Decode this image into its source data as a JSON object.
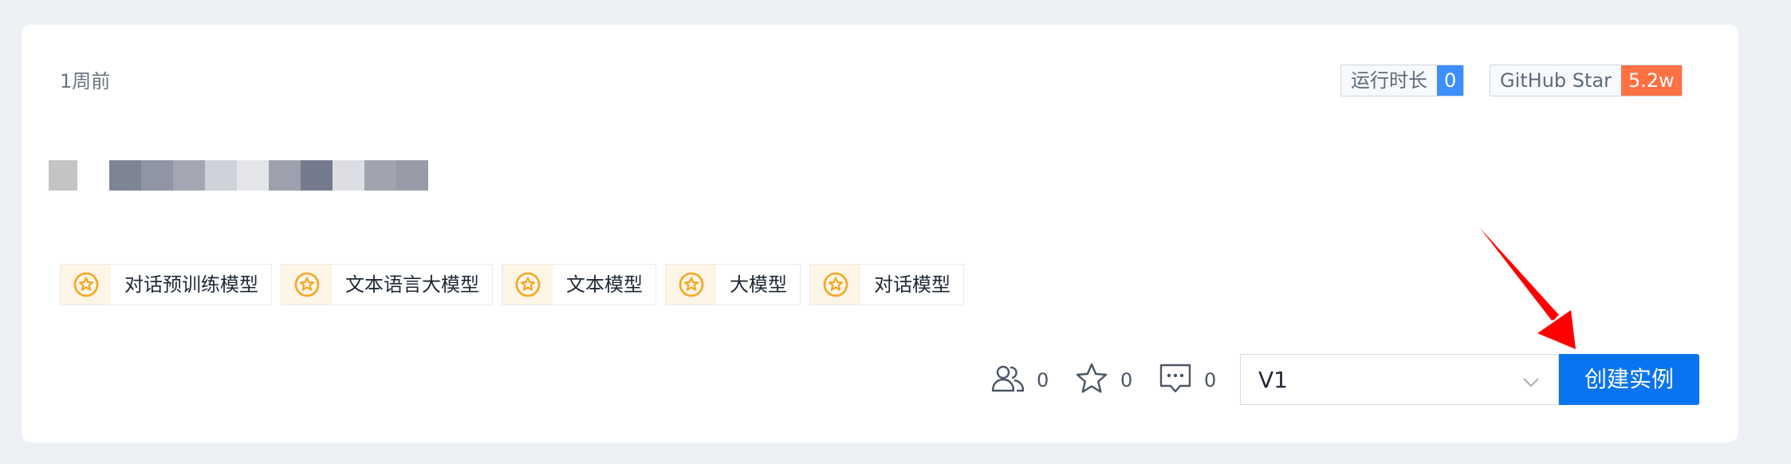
{
  "card": {
    "timestamp": "1周前"
  },
  "badges": {
    "runtime_label": "运行时长",
    "runtime_value": "0",
    "star_label": "GitHub Star",
    "star_value": "5.2w"
  },
  "tags": [
    {
      "label": "对话预训练模型",
      "icon": "star-circle-icon"
    },
    {
      "label": "文本语言大模型",
      "icon": "star-circle-icon"
    },
    {
      "label": "文本模型",
      "icon": "star-circle-icon"
    },
    {
      "label": "大模型",
      "icon": "star-circle-icon"
    },
    {
      "label": "对话模型",
      "icon": "star-circle-icon"
    }
  ],
  "stats": {
    "users_count": "0",
    "stars_count": "0",
    "comments_count": "0"
  },
  "version_select": {
    "value": "V1"
  },
  "create_button": {
    "label": "创建实例"
  },
  "colors": {
    "accent": "#0a74f0",
    "runtime_badge": "#3d8eff",
    "star_badge": "#ff7043",
    "tag_icon": "#f5a623",
    "annotation_arrow": "#ff0000"
  }
}
